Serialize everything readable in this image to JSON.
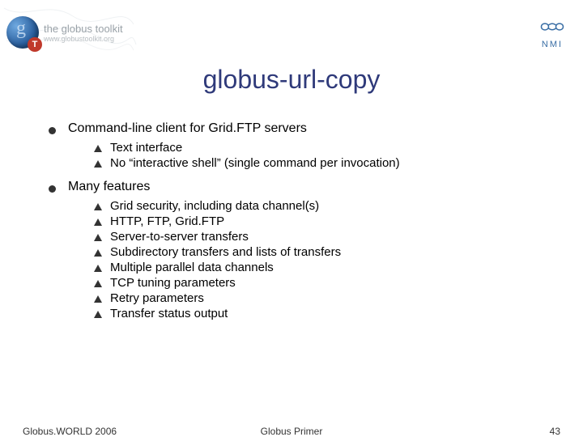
{
  "header": {
    "brand": "the globus toolkit",
    "url": "www.globustoolkit.org",
    "nmi": "NMI"
  },
  "title": "globus-url-copy",
  "bullets": [
    {
      "label": "Command-line client for Grid.FTP servers",
      "children": [
        "Text interface",
        "No “interactive shell” (single command per invocation)"
      ]
    },
    {
      "label": "Many features",
      "children": [
        "Grid security, including data channel(s)",
        "HTTP, FTP, Grid.FTP",
        "Server-to-server transfers",
        "Subdirectory transfers and lists of transfers",
        "Multiple parallel data channels",
        "TCP tuning parameters",
        "Retry parameters",
        "Transfer status output"
      ]
    }
  ],
  "footer": {
    "left": "Globus.WORLD 2006",
    "center": "Globus Primer",
    "right": "43"
  }
}
